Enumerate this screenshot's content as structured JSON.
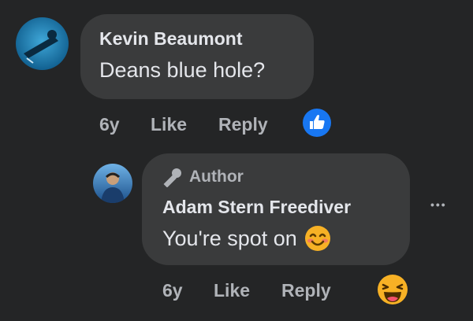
{
  "comments": [
    {
      "author": "Kevin Beaumont",
      "text": "Deans blue hole?",
      "time": "6y",
      "like_label": "Like",
      "reply_label": "Reply",
      "reaction": "like-icon"
    },
    {
      "badge": "Author",
      "author": "Adam Stern Freediver",
      "text": "You're spot on",
      "text_emoji": "smiling-face-icon",
      "time": "6y",
      "like_label": "Like",
      "reply_label": "Reply",
      "reaction": "haha-icon",
      "more_label": "•••"
    }
  ],
  "colors": {
    "background": "#242526",
    "bubble": "#3a3b3c",
    "primary_text": "#e4e6eb",
    "secondary_text": "#b0b3b8",
    "like_blue": "#1877f2",
    "emoji_yellow": "#f7b125"
  }
}
